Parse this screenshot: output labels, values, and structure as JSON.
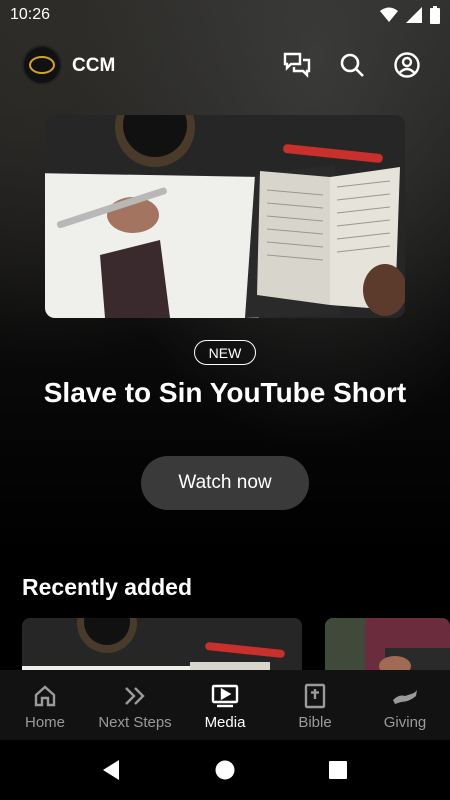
{
  "status_bar": {
    "time": "10:26",
    "icons": [
      "wifi-icon",
      "signal-icon",
      "battery-icon"
    ]
  },
  "header": {
    "app_name": "CCM",
    "icons": [
      "chat-icon",
      "search-icon",
      "account-icon"
    ]
  },
  "hero": {
    "badge": "NEW",
    "title": "Slave to Sin YouTube Short",
    "button_label": "Watch now"
  },
  "recent": {
    "title": "Recently added"
  },
  "bottom_nav": {
    "items": [
      {
        "label": "Home",
        "icon": "home-icon"
      },
      {
        "label": "Next Steps",
        "icon": "double-chevron-icon"
      },
      {
        "label": "Media",
        "icon": "media-icon"
      },
      {
        "label": "Bible",
        "icon": "bible-icon"
      },
      {
        "label": "Giving",
        "icon": "giving-icon"
      }
    ],
    "active": "Media"
  },
  "colors": {
    "accent": "#ffffff",
    "inactive": "#9a9a9a",
    "button_bg": "#3a3a3a",
    "logo_gold": "#d4a22a"
  }
}
